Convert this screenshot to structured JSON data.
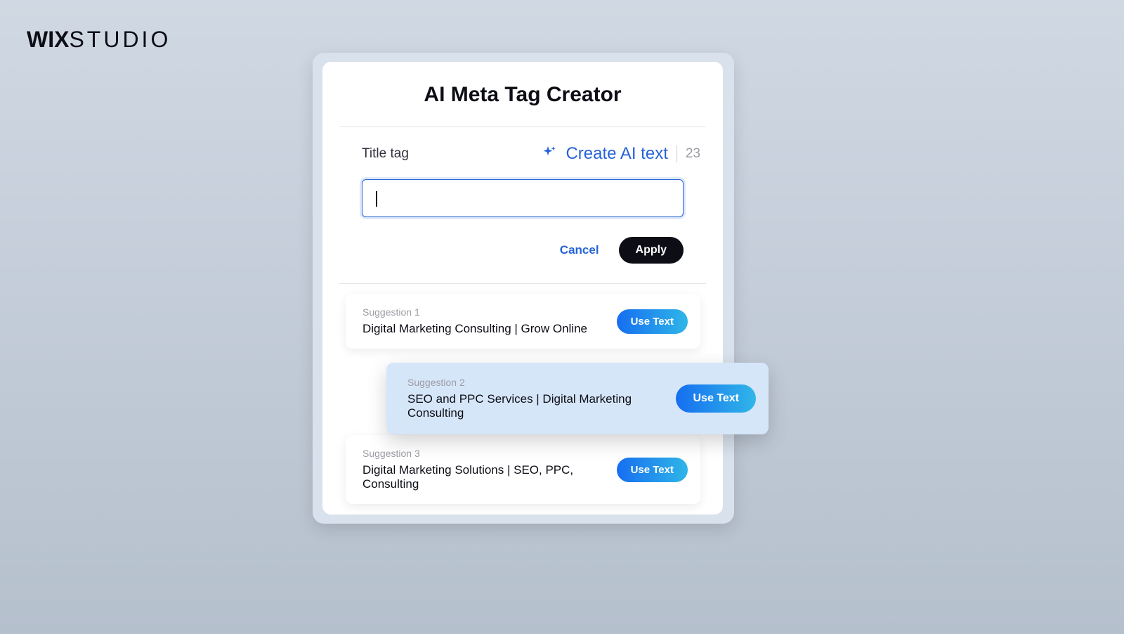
{
  "brand": {
    "part1": "WIX",
    "part2": "STUDIO"
  },
  "card": {
    "title": "AI Meta Tag Creator",
    "section_label": "Title tag",
    "create_ai_label": "Create AI text",
    "count": "23",
    "input_value": "",
    "cancel_label": "Cancel",
    "apply_label": "Apply"
  },
  "suggestions": [
    {
      "label": "Suggestion 1",
      "value": "Digital Marketing Consulting | Grow Online",
      "button": "Use Text"
    },
    {
      "label": "Suggestion 2",
      "value": "SEO and PPC Services | Digital Marketing Consulting",
      "button": "Use Text"
    },
    {
      "label": "Suggestion 3",
      "value": "Digital Marketing Solutions | SEO, PPC, Consulting",
      "button": "Use Text"
    }
  ]
}
